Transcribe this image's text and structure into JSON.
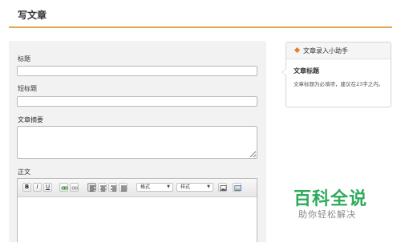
{
  "page": {
    "title": "写文章"
  },
  "form": {
    "title_label": "标题",
    "short_title_label": "短标题",
    "summary_label": "文章摘要",
    "body_label": "正文"
  },
  "toolbar": {
    "bold": "B",
    "italic": "I",
    "underline": "U",
    "format_select": "格式",
    "style_select": "样式"
  },
  "helper": {
    "title": "文章录入小助手",
    "tip_heading": "文章标题",
    "tip_text": "文章标题为必填项，建议在23字之内。"
  },
  "watermark": {
    "main": "百科全说",
    "sub": "助你轻松解决"
  },
  "colors": {
    "accent": "#e0a94f",
    "helper_icon": "#e67e22",
    "watermark": "#2eab5b"
  }
}
